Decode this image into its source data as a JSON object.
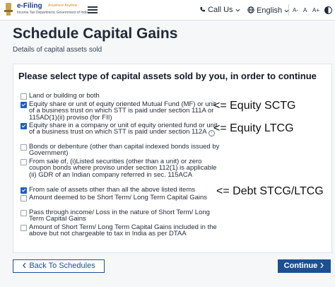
{
  "header": {
    "logo_title": "e-Filing",
    "logo_tagline": "Anywhere Anytime",
    "logo_subtitle": "Income Tax Department, Government of India",
    "call_us": "Call Us",
    "language": "English",
    "font_decrease": "A-",
    "font_default": "A",
    "font_increase": "A+"
  },
  "page": {
    "title": "Schedule Capital Gains",
    "subtitle": "Details of capital assets sold"
  },
  "card": {
    "heading": "Please select type of capital assets sold by you, in order to continue"
  },
  "options": [
    {
      "label": "Land or building or both",
      "checked": false
    },
    {
      "label": "Equity share or unit of equity oriented Mutual Fund (MF) or unit of a business trust on which STT is paid under section 111A or 115AD(1)(ii) proviso (for FII)",
      "checked": true
    },
    {
      "label": "Equity share in a company or unit of equity oriented fund or unit of a business trust on which STT is paid under section 112A",
      "checked": true
    },
    {
      "label": "Bonds or debenture (other than capital indexed bonds issued by Government)",
      "checked": false
    },
    {
      "label": "From sale of, (i)Listed securities (other than a unit) or zero coupon bonds where proviso under section 112(1) is applicable (ii) GDR of an Indian company referred in sec. 115ACA",
      "checked": false
    },
    {
      "label": "From sale of assets other than all the above listed items",
      "checked": true
    },
    {
      "label": "Amount deemed to be Short Term/ Long Term Capital Gains",
      "checked": false
    },
    {
      "label": "Pass through income/ Loss in the nature of Short Term/ Long Term Capital Gains",
      "checked": false
    },
    {
      "label": "Amount of Short Term/ Long Term Capital Gains included in the above but not chargeable to tax in India as per DTAA",
      "checked": false
    }
  ],
  "annotations": {
    "equity_sctg": "<= Equity SCTG",
    "equity_ltcg": "<= Equity LTCG",
    "debt": "<= Debt STCG/LTCG"
  },
  "footer": {
    "back_label": "Back To Schedules",
    "continue_label": "Continue"
  },
  "colors": {
    "primary": "#1d4f91",
    "checkbox": "#1d5fb8"
  }
}
